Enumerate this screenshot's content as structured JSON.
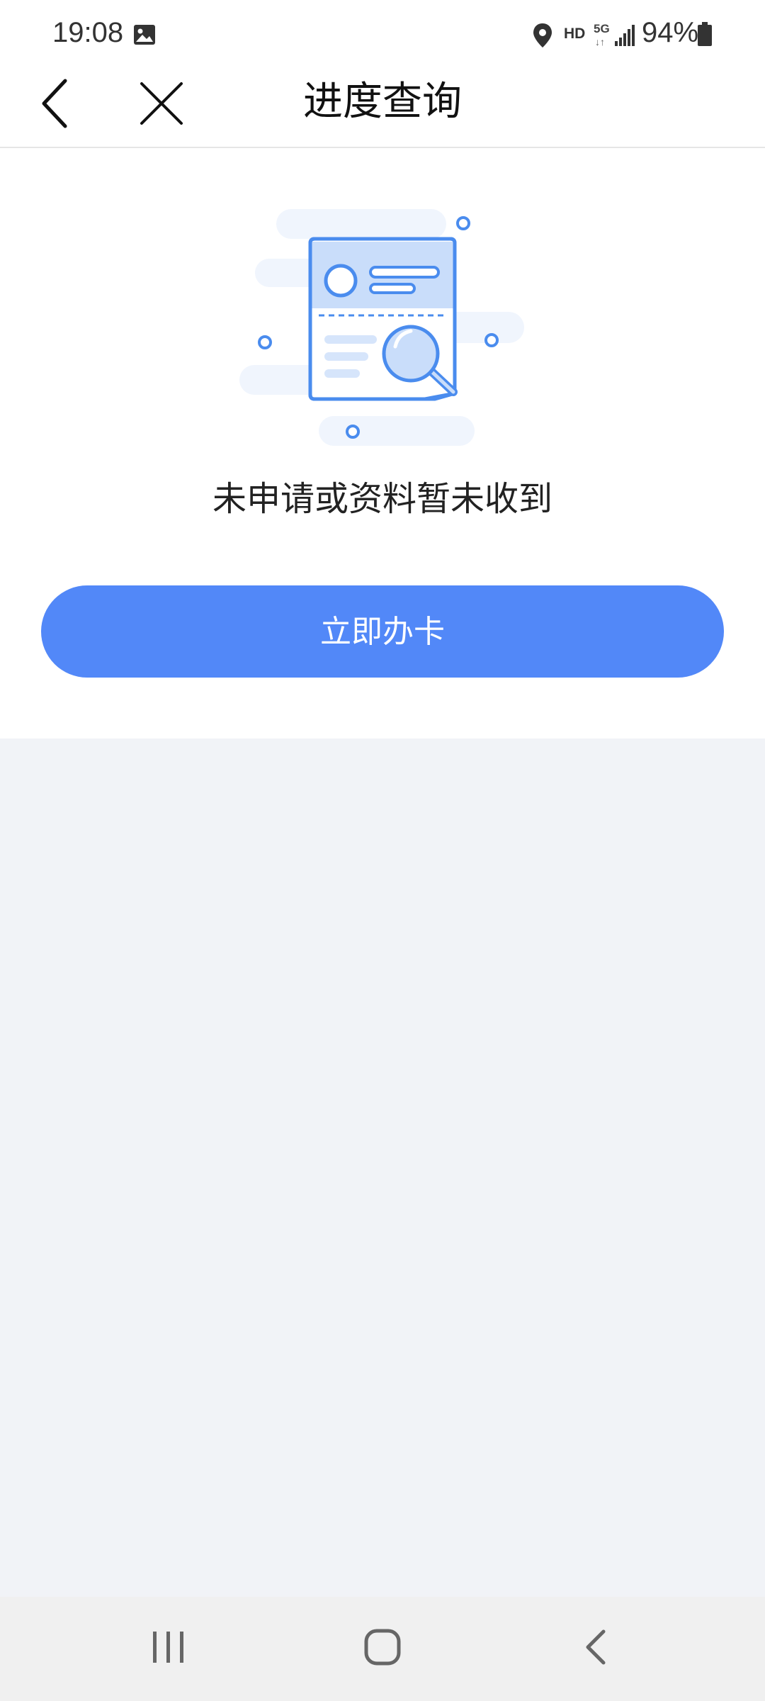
{
  "status_bar": {
    "time": "19:08",
    "hd_label": "HD",
    "network_label": "5G",
    "battery": "94%",
    "icons": [
      "image-icon",
      "location-icon",
      "signal-icon",
      "battery-icon"
    ]
  },
  "nav": {
    "title": "进度查询",
    "icons": [
      "back-icon",
      "close-icon"
    ]
  },
  "empty_state": {
    "illustration": "document-search-illustration",
    "message": "未申请或资料暂未收到",
    "button_label": "立即办卡"
  },
  "system_nav": {
    "icons": [
      "recent-apps-icon",
      "home-icon",
      "system-back-icon"
    ]
  },
  "colors": {
    "accent": "#5288f8",
    "page_background": "#f1f3f7",
    "illustration_blue": "#4a8cee"
  }
}
